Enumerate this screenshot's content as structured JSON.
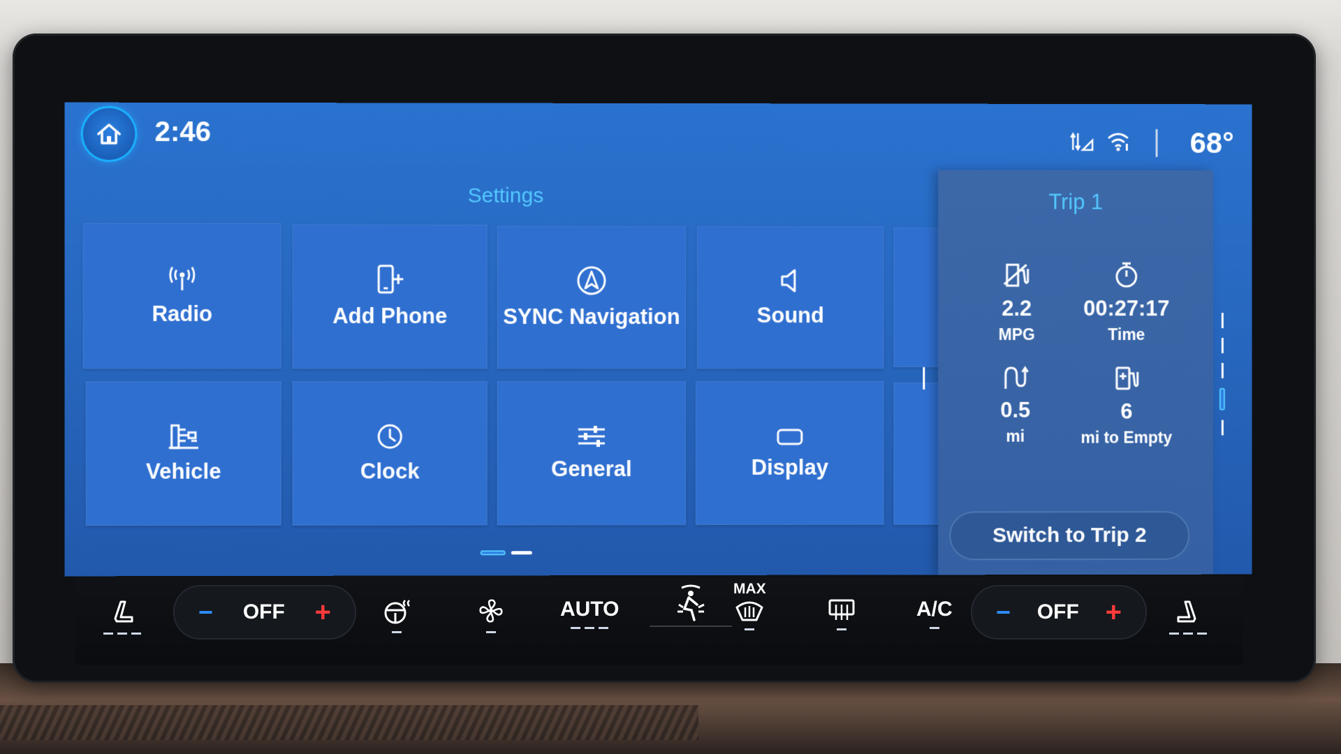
{
  "status": {
    "time": "2:46",
    "temperature": "68°"
  },
  "settings": {
    "title": "Settings",
    "tiles": [
      {
        "label": "Radio",
        "icon": "radio-antenna-icon"
      },
      {
        "label": "Add Phone",
        "icon": "add-phone-icon"
      },
      {
        "label": "SYNC Navigation",
        "icon": "navigation-arrow-icon"
      },
      {
        "label": "Sound",
        "icon": "speaker-icon"
      },
      {
        "label": "Vehicle",
        "icon": "vehicle-icon"
      },
      {
        "label": "Clock",
        "icon": "clock-icon"
      },
      {
        "label": "General",
        "icon": "sliders-icon"
      },
      {
        "label": "Display",
        "icon": "display-icon"
      }
    ]
  },
  "trip": {
    "title": "Trip 1",
    "stats": [
      {
        "value": "2.2",
        "unit": "MPG",
        "icon": "fuel-economy-icon"
      },
      {
        "value": "00:27:17",
        "unit": "Time",
        "icon": "stopwatch-icon"
      },
      {
        "value": "0.5",
        "unit": "mi",
        "icon": "distance-icon"
      },
      {
        "value": "6",
        "unit": "mi to Empty",
        "icon": "fuel-pump-icon"
      }
    ],
    "switch_label": "Switch to Trip 2"
  },
  "climate": {
    "left_temp": "OFF",
    "right_temp": "OFF",
    "minus": "−",
    "plus": "+",
    "auto": "AUTO",
    "max": "MAX",
    "ac": "A/C"
  },
  "colors": {
    "accent": "#53c8ff",
    "screen": "#2868c2",
    "tile": "#2f6fd0",
    "minus": "#2f8dff",
    "plus": "#ff3b3b"
  }
}
